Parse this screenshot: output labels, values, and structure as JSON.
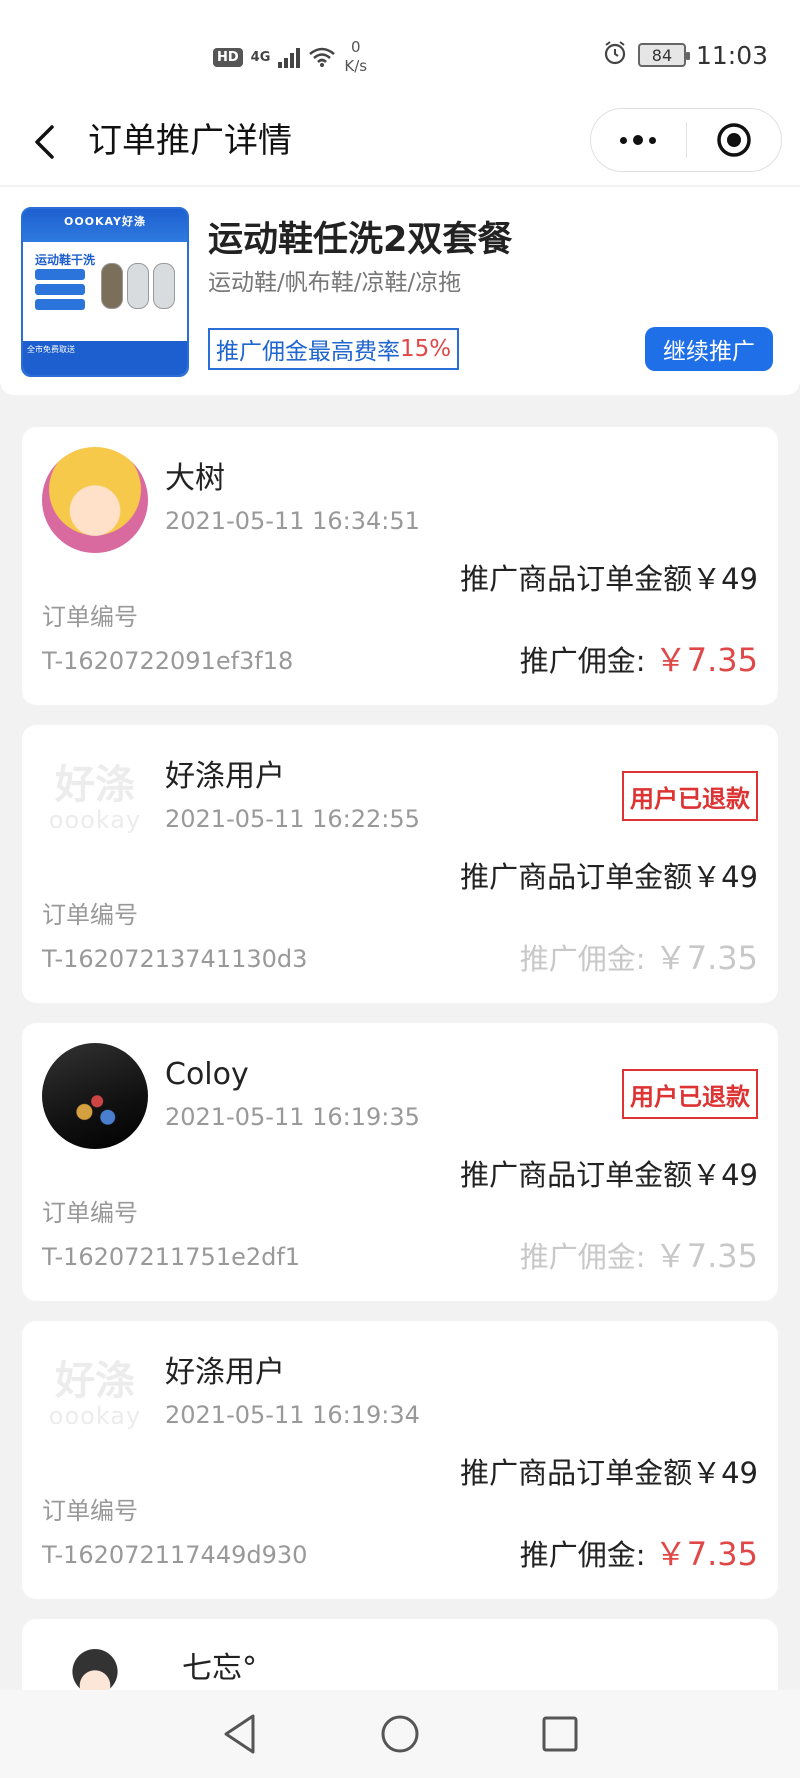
{
  "status_bar": {
    "hd": "HD",
    "network": "4G",
    "speed_value": "0",
    "speed_unit": "K/s",
    "battery": "84",
    "time": "11:03"
  },
  "nav": {
    "title": "订单推广详情"
  },
  "product": {
    "thumb_brand": "OOOKAY好涤",
    "thumb_title": "运动鞋干洗",
    "thumb_footer": "全市免费取送",
    "name": "运动鞋任洗2双套餐",
    "subtitle": "运动鞋/帆布鞋/凉鞋/凉拖",
    "rate_label": "推广佣金最高费率",
    "rate_value": "15%",
    "continue_label": "继续推广"
  },
  "orders": [
    {
      "user": "大树",
      "time": "2021-05-11 16:34:51",
      "amount": "推广商品订单金额￥49",
      "order_no_label": "订单编号",
      "order_no": "T-1620722091ef3f18",
      "commission_label": "推广佣金:",
      "commission_value": "￥7.35",
      "refund": ""
    },
    {
      "user": "好涤用户",
      "time": "2021-05-11 16:22:55",
      "amount": "推广商品订单金额￥49",
      "order_no_label": "订单编号",
      "order_no": "T-16207213741130d3",
      "commission_label": "推广佣金:",
      "commission_value": "￥7.35",
      "refund": "用户已退款"
    },
    {
      "user": "Coloy",
      "time": "2021-05-11 16:19:35",
      "amount": "推广商品订单金额￥49",
      "order_no_label": "订单编号",
      "order_no": "T-16207211751e2df1",
      "commission_label": "推广佣金:",
      "commission_value": "￥7.35",
      "refund": "用户已退款"
    },
    {
      "user": "好涤用户",
      "time": "2021-05-11 16:19:34",
      "amount": "推广商品订单金额￥49",
      "order_no_label": "订单编号",
      "order_no": "T-162072117449d930",
      "commission_label": "推广佣金:",
      "commission_value": "￥7.35",
      "refund": ""
    },
    {
      "user": "七忘°"
    }
  ],
  "avatar_watermark": {
    "cn": "好涤",
    "en": "oookay"
  },
  "colors": {
    "accent": "#1f6fe8",
    "price_red": "#e04848",
    "refund_red": "#d33333",
    "muted": "#999999"
  }
}
